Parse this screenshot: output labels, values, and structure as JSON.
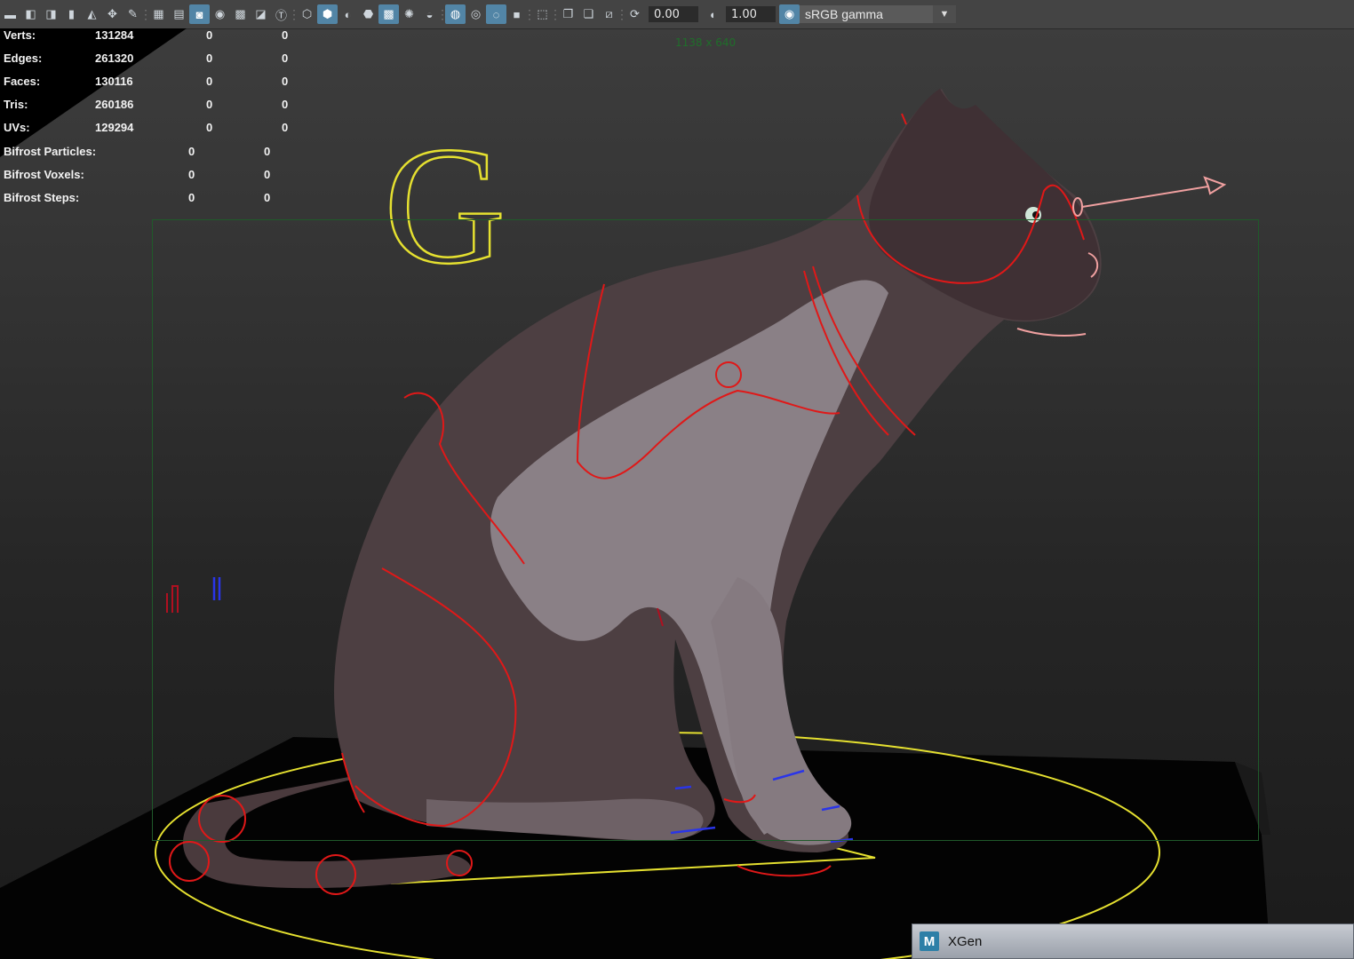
{
  "toolbar": {
    "exposure_value": "0.00",
    "gamma_value": "1.00",
    "color_space": "sRGB gamma",
    "icons": [
      "camera-select-icon",
      "camera-lock-icon",
      "camera-attributes-icon",
      "bookmark-icon",
      "image-plane-icon",
      "2d-pan-zoom-icon",
      "grease-pencil-icon",
      "grid-icon",
      "film-gate-icon",
      "resolution-gate-icon",
      "gate-mask-icon",
      "field-chart-icon",
      "safe-action-icon",
      "safe-title-icon",
      "wireframe-icon",
      "smooth-shade-icon",
      "use-default-material-icon",
      "wireframe-on-shaded-icon",
      "xray-icon",
      "lights-icon",
      "shadows-icon",
      "screen-space-ao-icon",
      "motion-blur-icon",
      "multisample-aa-icon",
      "depth-of-field-icon",
      "isolate-select-icon",
      "xray-joints-icon",
      "xray-active-components-icon",
      "backface-culling-icon",
      "exposure-icon",
      "gamma-icon",
      "color-management-icon"
    ]
  },
  "hud": {
    "rows": [
      {
        "label": "Verts:",
        "total": "131284",
        "selected": "0",
        "highlighted": "0"
      },
      {
        "label": "Edges:",
        "total": "261320",
        "selected": "0",
        "highlighted": "0"
      },
      {
        "label": "Faces:",
        "total": "130116",
        "selected": "0",
        "highlighted": "0"
      },
      {
        "label": "Tris:",
        "total": "260186",
        "selected": "0",
        "highlighted": "0"
      },
      {
        "label": "UVs:",
        "total": "129294",
        "selected": "0",
        "highlighted": "0"
      }
    ],
    "bifrost_rows": [
      {
        "label": "Bifrost Particles:",
        "a": "0",
        "b": "0"
      },
      {
        "label": "Bifrost Voxels:",
        "a": "0",
        "b": "0"
      },
      {
        "label": "Bifrost Steps:",
        "a": "0",
        "b": "0"
      }
    ]
  },
  "viewport": {
    "resolution_label": "1138 x 640",
    "control_letter": "G",
    "colors": {
      "control_red": "#e01818",
      "control_yellow": "#e5e030",
      "control_blue": "#2a35e8",
      "control_pink": "#f0a0a0",
      "gate_green": "#1f5a2a"
    }
  },
  "taskbar": {
    "xgen_title": "XGen",
    "xgen_logo": "M"
  }
}
